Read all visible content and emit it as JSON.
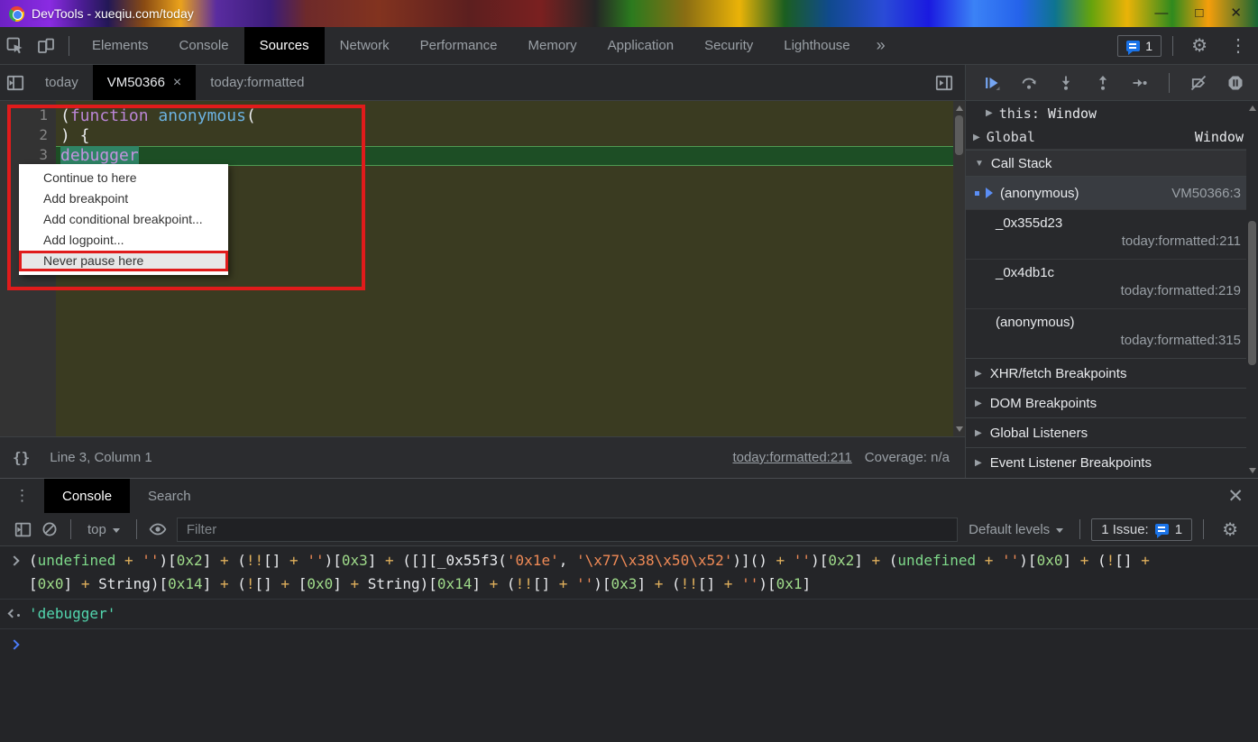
{
  "title_bar": {
    "title": "DevTools - xueqiu.com/today",
    "minimize_glyph": "—",
    "maximize_glyph": "□",
    "close_glyph": "✕"
  },
  "main_toolbar": {
    "tabs": [
      "Elements",
      "Console",
      "Sources",
      "Network",
      "Performance",
      "Memory",
      "Application",
      "Security",
      "Lighthouse"
    ],
    "active_tab": "Sources",
    "overflow_glyph": "»",
    "issues_count": "1",
    "settings_glyph": "⚙",
    "menu_glyph": "⋮"
  },
  "sources_panel": {
    "file_tabs": [
      {
        "label": "today",
        "active": false
      },
      {
        "label": "VM50366",
        "active": true
      },
      {
        "label": "today:formatted",
        "active": false
      }
    ],
    "active_tab_close_glyph": "×",
    "editor_lines": [
      {
        "num": "1",
        "exec": false,
        "tokens": [
          [
            "p",
            "("
          ],
          [
            "kw",
            "function"
          ],
          [
            "p",
            " "
          ],
          [
            "fn",
            "anonymous"
          ],
          [
            "p",
            "("
          ]
        ]
      },
      {
        "num": "2",
        "exec": false,
        "tokens": [
          [
            "p",
            ") {"
          ]
        ]
      },
      {
        "num": "3",
        "exec": true,
        "tokens": [
          [
            "hl",
            "debugger"
          ]
        ]
      }
    ],
    "context_menu": {
      "items": [
        "Continue to here",
        "Add breakpoint",
        "Add conditional breakpoint...",
        "Add logpoint...",
        "Never pause here"
      ],
      "annotated_item": "Never pause here"
    },
    "status_bar": {
      "pretty_print_glyph": "{}",
      "position": "Line 3, Column 1",
      "link": "today:formatted:211",
      "coverage": "Coverage: n/a"
    }
  },
  "debugger_sidebar": {
    "scope_rows": [
      {
        "glyph": "▶",
        "name": "this",
        "colon": ": ",
        "value": "Window"
      },
      {
        "glyph": "▶",
        "name": "Global",
        "value": "Window"
      }
    ],
    "call_stack_glyph": "▼",
    "call_stack_header": "Call Stack",
    "frames": [
      {
        "name": "(anonymous)",
        "location": "VM50366:3",
        "current": true
      },
      {
        "name": "_0x355d23",
        "location": "today:formatted:211",
        "current": false
      },
      {
        "name": "_0x4db1c",
        "location": "today:formatted:219",
        "current": false
      },
      {
        "name": "(anonymous)",
        "location": "today:formatted:315",
        "current": false
      }
    ],
    "section_glyph": "▶",
    "sections": [
      "XHR/fetch Breakpoints",
      "DOM Breakpoints",
      "Global Listeners",
      "Event Listener Breakpoints"
    ]
  },
  "console_drawer": {
    "menu_glyph": "⋮",
    "close_glyph": "✕",
    "tabs": [
      {
        "label": "Console",
        "active": true
      },
      {
        "label": "Search",
        "active": false
      }
    ],
    "toolbar": {
      "context_label": "top",
      "filter_placeholder": "Filter",
      "levels_label": "Default levels",
      "issues_label": "1 Issue:",
      "issues_count": "1"
    },
    "input_echo_lines": [
      [
        [
          "p",
          "("
        ],
        [
          "k",
          "undefined"
        ],
        [
          "o",
          " + "
        ],
        [
          "s",
          "''"
        ],
        [
          "p",
          ")["
        ],
        [
          "n",
          "0x2"
        ],
        [
          "p",
          "]"
        ],
        [
          "o",
          " + "
        ],
        [
          "p",
          "("
        ],
        [
          "o",
          "!!"
        ],
        [
          "p",
          "[]"
        ],
        [
          "o",
          " + "
        ],
        [
          "s",
          "''"
        ],
        [
          "p",
          ")["
        ],
        [
          "n",
          "0x3"
        ],
        [
          "p",
          "]"
        ],
        [
          "o",
          " + "
        ],
        [
          "p",
          "([]["
        ],
        [
          "d",
          "_0x55f3"
        ],
        [
          "p",
          "("
        ],
        [
          "s",
          "'0x1e'"
        ],
        [
          "p",
          ", "
        ],
        [
          "s",
          "'\\x77\\x38\\x50\\x52'"
        ],
        [
          "p",
          ")]()"
        ],
        [
          "o",
          " + "
        ],
        [
          "s",
          "''"
        ],
        [
          "p",
          ")["
        ],
        [
          "n",
          "0x2"
        ],
        [
          "p",
          "]"
        ],
        [
          "o",
          " + "
        ],
        [
          "p",
          "("
        ],
        [
          "k",
          "undefined"
        ],
        [
          "o",
          " + "
        ],
        [
          "s",
          "''"
        ],
        [
          "p",
          ")["
        ],
        [
          "n",
          "0x0"
        ],
        [
          "p",
          "]"
        ],
        [
          "o",
          " + "
        ],
        [
          "p",
          "("
        ],
        [
          "o",
          "!"
        ],
        [
          "p",
          "[]"
        ],
        [
          "o",
          " +"
        ]
      ],
      [
        [
          "p",
          "["
        ],
        [
          "n",
          "0x0"
        ],
        [
          "p",
          "]"
        ],
        [
          "o",
          " + "
        ],
        [
          "d",
          "String"
        ],
        [
          "p",
          ")["
        ],
        [
          "n",
          "0x14"
        ],
        [
          "p",
          "]"
        ],
        [
          "o",
          " + "
        ],
        [
          "p",
          "("
        ],
        [
          "o",
          "!"
        ],
        [
          "p",
          "[]"
        ],
        [
          "o",
          " + "
        ],
        [
          "p",
          "["
        ],
        [
          "n",
          "0x0"
        ],
        [
          "p",
          "]"
        ],
        [
          "o",
          " + "
        ],
        [
          "d",
          "String"
        ],
        [
          "p",
          ")["
        ],
        [
          "n",
          "0x14"
        ],
        [
          "p",
          "]"
        ],
        [
          "o",
          " + "
        ],
        [
          "p",
          "("
        ],
        [
          "o",
          "!!"
        ],
        [
          "p",
          "[]"
        ],
        [
          "o",
          " + "
        ],
        [
          "s",
          "''"
        ],
        [
          "p",
          ")["
        ],
        [
          "n",
          "0x3"
        ],
        [
          "p",
          "]"
        ],
        [
          "o",
          " + "
        ],
        [
          "p",
          "("
        ],
        [
          "o",
          "!!"
        ],
        [
          "p",
          "[]"
        ],
        [
          "o",
          " + "
        ],
        [
          "s",
          "''"
        ],
        [
          "p",
          ")["
        ],
        [
          "n",
          "0x1"
        ],
        [
          "p",
          "]"
        ]
      ]
    ],
    "result_value": "'debugger'"
  },
  "colors": {
    "annotation": "#e01b1b",
    "accent_blue": "#1a73e8",
    "execution_line": "#1d4e25",
    "token_highlight": "#2f8465",
    "resume_blue": "#75a5f2"
  }
}
